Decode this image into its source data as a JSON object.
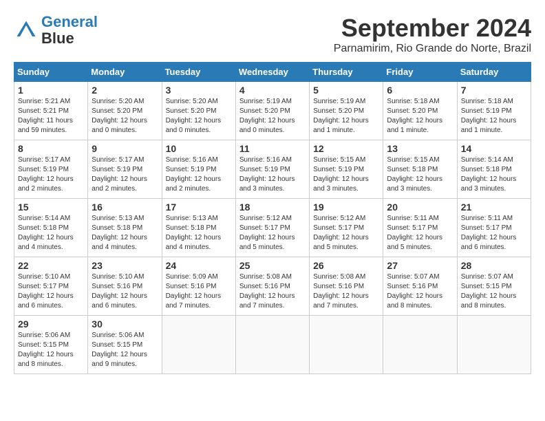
{
  "header": {
    "logo_line1": "General",
    "logo_line2": "Blue",
    "month": "September 2024",
    "location": "Parnamirim, Rio Grande do Norte, Brazil"
  },
  "days_of_week": [
    "Sunday",
    "Monday",
    "Tuesday",
    "Wednesday",
    "Thursday",
    "Friday",
    "Saturday"
  ],
  "weeks": [
    [
      {
        "day": "1",
        "info": "Sunrise: 5:21 AM\nSunset: 5:21 PM\nDaylight: 11 hours\nand 59 minutes."
      },
      {
        "day": "2",
        "info": "Sunrise: 5:20 AM\nSunset: 5:20 PM\nDaylight: 12 hours\nand 0 minutes."
      },
      {
        "day": "3",
        "info": "Sunrise: 5:20 AM\nSunset: 5:20 PM\nDaylight: 12 hours\nand 0 minutes."
      },
      {
        "day": "4",
        "info": "Sunrise: 5:19 AM\nSunset: 5:20 PM\nDaylight: 12 hours\nand 0 minutes."
      },
      {
        "day": "5",
        "info": "Sunrise: 5:19 AM\nSunset: 5:20 PM\nDaylight: 12 hours\nand 1 minute."
      },
      {
        "day": "6",
        "info": "Sunrise: 5:18 AM\nSunset: 5:20 PM\nDaylight: 12 hours\nand 1 minute."
      },
      {
        "day": "7",
        "info": "Sunrise: 5:18 AM\nSunset: 5:19 PM\nDaylight: 12 hours\nand 1 minute."
      }
    ],
    [
      {
        "day": "8",
        "info": "Sunrise: 5:17 AM\nSunset: 5:19 PM\nDaylight: 12 hours\nand 2 minutes."
      },
      {
        "day": "9",
        "info": "Sunrise: 5:17 AM\nSunset: 5:19 PM\nDaylight: 12 hours\nand 2 minutes."
      },
      {
        "day": "10",
        "info": "Sunrise: 5:16 AM\nSunset: 5:19 PM\nDaylight: 12 hours\nand 2 minutes."
      },
      {
        "day": "11",
        "info": "Sunrise: 5:16 AM\nSunset: 5:19 PM\nDaylight: 12 hours\nand 3 minutes."
      },
      {
        "day": "12",
        "info": "Sunrise: 5:15 AM\nSunset: 5:19 PM\nDaylight: 12 hours\nand 3 minutes."
      },
      {
        "day": "13",
        "info": "Sunrise: 5:15 AM\nSunset: 5:18 PM\nDaylight: 12 hours\nand 3 minutes."
      },
      {
        "day": "14",
        "info": "Sunrise: 5:14 AM\nSunset: 5:18 PM\nDaylight: 12 hours\nand 3 minutes."
      }
    ],
    [
      {
        "day": "15",
        "info": "Sunrise: 5:14 AM\nSunset: 5:18 PM\nDaylight: 12 hours\nand 4 minutes."
      },
      {
        "day": "16",
        "info": "Sunrise: 5:13 AM\nSunset: 5:18 PM\nDaylight: 12 hours\nand 4 minutes."
      },
      {
        "day": "17",
        "info": "Sunrise: 5:13 AM\nSunset: 5:18 PM\nDaylight: 12 hours\nand 4 minutes."
      },
      {
        "day": "18",
        "info": "Sunrise: 5:12 AM\nSunset: 5:17 PM\nDaylight: 12 hours\nand 5 minutes."
      },
      {
        "day": "19",
        "info": "Sunrise: 5:12 AM\nSunset: 5:17 PM\nDaylight: 12 hours\nand 5 minutes."
      },
      {
        "day": "20",
        "info": "Sunrise: 5:11 AM\nSunset: 5:17 PM\nDaylight: 12 hours\nand 5 minutes."
      },
      {
        "day": "21",
        "info": "Sunrise: 5:11 AM\nSunset: 5:17 PM\nDaylight: 12 hours\nand 6 minutes."
      }
    ],
    [
      {
        "day": "22",
        "info": "Sunrise: 5:10 AM\nSunset: 5:17 PM\nDaylight: 12 hours\nand 6 minutes."
      },
      {
        "day": "23",
        "info": "Sunrise: 5:10 AM\nSunset: 5:16 PM\nDaylight: 12 hours\nand 6 minutes."
      },
      {
        "day": "24",
        "info": "Sunrise: 5:09 AM\nSunset: 5:16 PM\nDaylight: 12 hours\nand 7 minutes."
      },
      {
        "day": "25",
        "info": "Sunrise: 5:08 AM\nSunset: 5:16 PM\nDaylight: 12 hours\nand 7 minutes."
      },
      {
        "day": "26",
        "info": "Sunrise: 5:08 AM\nSunset: 5:16 PM\nDaylight: 12 hours\nand 7 minutes."
      },
      {
        "day": "27",
        "info": "Sunrise: 5:07 AM\nSunset: 5:16 PM\nDaylight: 12 hours\nand 8 minutes."
      },
      {
        "day": "28",
        "info": "Sunrise: 5:07 AM\nSunset: 5:15 PM\nDaylight: 12 hours\nand 8 minutes."
      }
    ],
    [
      {
        "day": "29",
        "info": "Sunrise: 5:06 AM\nSunset: 5:15 PM\nDaylight: 12 hours\nand 8 minutes."
      },
      {
        "day": "30",
        "info": "Sunrise: 5:06 AM\nSunset: 5:15 PM\nDaylight: 12 hours\nand 9 minutes."
      },
      {
        "day": "",
        "info": ""
      },
      {
        "day": "",
        "info": ""
      },
      {
        "day": "",
        "info": ""
      },
      {
        "day": "",
        "info": ""
      },
      {
        "day": "",
        "info": ""
      }
    ]
  ]
}
